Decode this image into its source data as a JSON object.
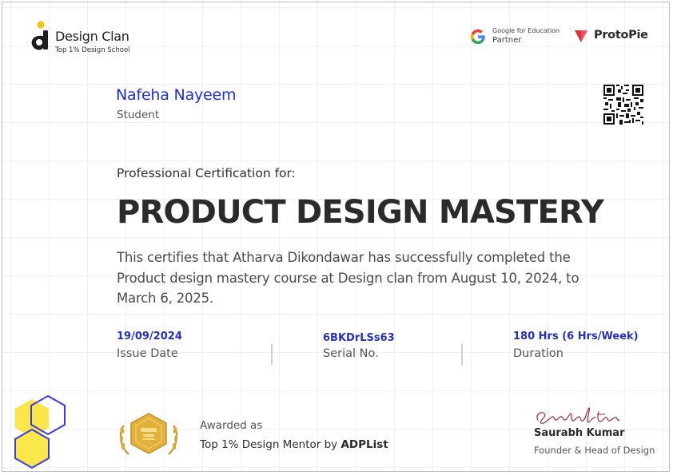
{
  "brand": {
    "name": "Design Clan",
    "tagline": "Top 1% Design School"
  },
  "partners": {
    "google_line1": "Google for Education",
    "google_line2": "Partner",
    "protopie": "ProtoPie"
  },
  "recipient": {
    "name": "Nafeha Nayeem",
    "role": "Student"
  },
  "certificate": {
    "heading": "Professional Certification for:",
    "course": "PRODUCT DESIGN MASTERY",
    "description": "This certifies that Atharva Dikondawar has successfully completed the Product design mastery course at Design clan from August 10, 2024, to March 6, 2025."
  },
  "details": {
    "issue_date_value": "19/09/2024",
    "issue_date_label": "Issue Date",
    "serial_value": "6BKDrLSs63",
    "serial_label": "Serial No.",
    "duration_value": "180 Hrs (6 Hrs/Week)",
    "duration_label": "Duration"
  },
  "award": {
    "intro": "Awarded as",
    "text": "Top 1% Design Mentor by ",
    "org": "ADPList"
  },
  "signer": {
    "signature": "Saurabh Kumar",
    "name": "Saurabh Kumar",
    "title": "Founder & Head of Design"
  },
  "colors": {
    "accent_blue": "#1f2fd8",
    "hex_yellow": "#fbe74a",
    "hex_blue": "#3e39e6",
    "protopie_red": "#f24b5b",
    "badge_gold": "#e2b13c"
  }
}
